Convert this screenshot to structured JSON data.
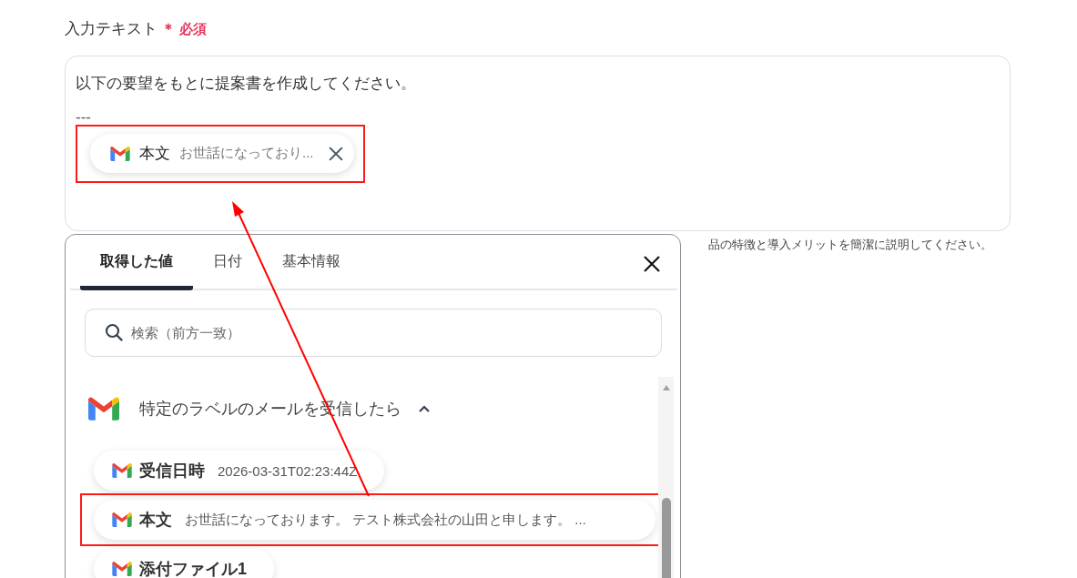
{
  "field": {
    "label": "入力テキスト",
    "required_mark": "＊",
    "required_text": "必須",
    "lines": [
      "以下の要望をもとに提案書を作成してください。",
      "---"
    ],
    "token": {
      "label": "本文",
      "value": "お世話になっており...",
      "highlighted": true
    },
    "hint": "品の特徴と導入メリットを簡潔に説明してください。"
  },
  "popup": {
    "tabs": [
      {
        "label": "取得した値",
        "selected": true
      },
      {
        "label": "日付",
        "selected": false
      },
      {
        "label": "基本情報",
        "selected": false
      }
    ],
    "search": {
      "placeholder": "検索（前方一致）"
    },
    "group": {
      "title": "特定のラベルのメールを受信したら",
      "expanded": true
    },
    "items": [
      {
        "label": "受信日時",
        "value": "2026-03-31T02:23:44Z",
        "highlighted": false
      },
      {
        "label": "本文",
        "value": "お世話になっております。 テスト株式会社の山田と申します。 ...",
        "highlighted": true
      },
      {
        "label": "添付ファイル1",
        "highlighted": false
      }
    ]
  }
}
